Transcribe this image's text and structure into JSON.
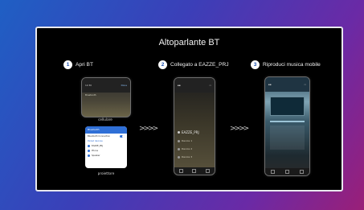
{
  "slide": {
    "title": "Altoparlante BT"
  },
  "steps": [
    {
      "num": "1",
      "label": "Apri BT"
    },
    {
      "num": "2",
      "label": "Collegato a  EAZZE_PRJ"
    },
    {
      "num": "3",
      "label": "Riproduci musica mobile"
    }
  ],
  "captions": {
    "phone": "cellulare",
    "projector": "proiettore"
  },
  "phone1": {
    "time": "12:30",
    "header": "Bluetooth",
    "action": "Done"
  },
  "phone2": {
    "device": "EAZZE_PRJ",
    "items": [
      "Device 1",
      "Device 2",
      "Device 3"
    ]
  },
  "projector_menu": {
    "header": "Bluetooth",
    "toggle_label": "Bluetooth Connection",
    "section": "Paired devices",
    "items": [
      "EAZZE_PRJ",
      "Phone",
      "Speaker"
    ]
  },
  "chevrons": ">>>>"
}
